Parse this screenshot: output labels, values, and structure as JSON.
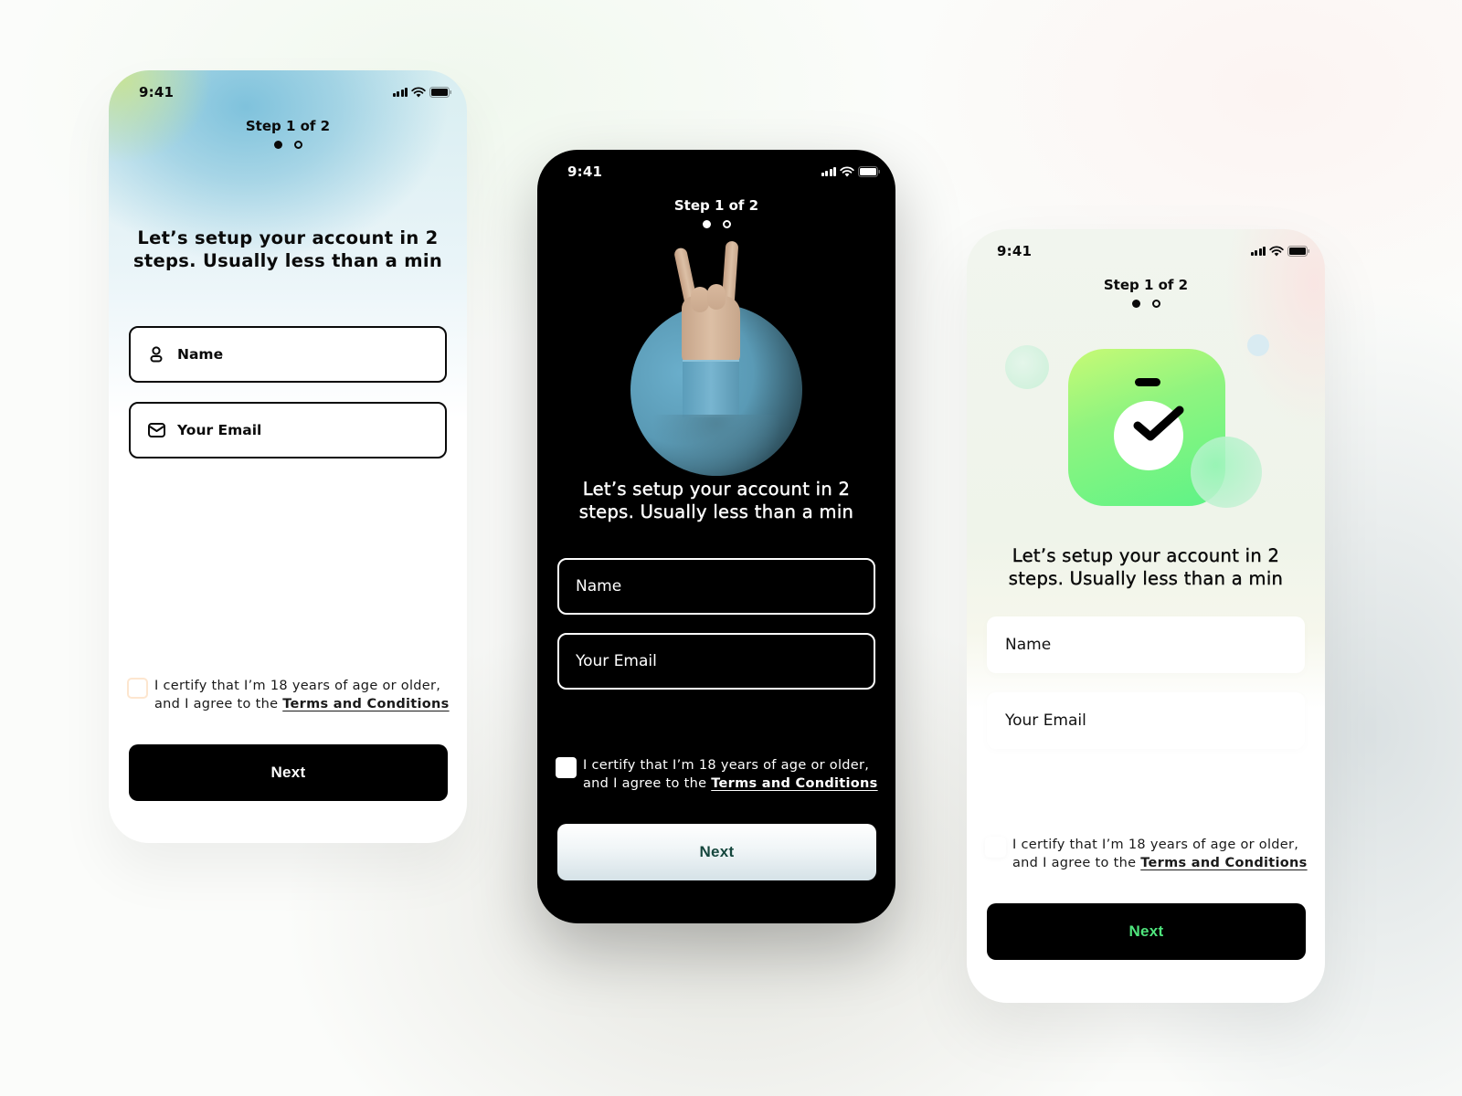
{
  "screens": [
    {
      "theme": "light-gradient",
      "status_bar": {
        "time": "9:41"
      },
      "step": {
        "label": "Step 1 of 2",
        "current": 1,
        "total": 2
      },
      "headline": "Let’s setup your account in 2 steps. Usually less than a min",
      "fields": {
        "name": {
          "placeholder": "Name",
          "icon": "user-icon"
        },
        "email": {
          "placeholder": "Your Email",
          "icon": "mail-icon"
        }
      },
      "consent": {
        "text": "I certify that I’m 18 years of age or older, and I agree to the ",
        "link": "Terms and Conditions",
        "checked": false
      },
      "next_button": {
        "label": "Next"
      },
      "colors": {
        "button_bg": "#000000",
        "button_text": "#ffffff"
      }
    },
    {
      "theme": "dark",
      "status_bar": {
        "time": "9:41"
      },
      "step": {
        "label": "Step 1 of 2",
        "current": 1,
        "total": 2
      },
      "illustration": "rock-hand-illustration",
      "headline": "Let’s setup your account in 2 steps. Usually less than a min",
      "fields": {
        "name": {
          "placeholder": "Name"
        },
        "email": {
          "placeholder": "Your Email"
        }
      },
      "consent": {
        "text": "I certify that I’m 18 years of age or older, and I agree to the ",
        "link": "Terms and Conditions",
        "checked": false
      },
      "next_button": {
        "label": "Next"
      },
      "colors": {
        "button_bg": "#eef3f5",
        "button_text": "#15463d"
      }
    },
    {
      "theme": "light-green",
      "status_bar": {
        "time": "9:41"
      },
      "step": {
        "label": "Step 1 of 2",
        "current": 1,
        "total": 2
      },
      "illustration": "stopwatch-check-illustration",
      "headline": "Let’s setup your account in 2 steps. Usually less than a min",
      "fields": {
        "name": {
          "placeholder": "Name"
        },
        "email": {
          "placeholder": "Your Email"
        }
      },
      "consent": {
        "text": "I certify that I’m 18 years of age or older, and I agree to the ",
        "link": "Terms and Conditions",
        "checked": false
      },
      "next_button": {
        "label": "Next"
      },
      "colors": {
        "button_bg": "#000000",
        "button_text": "#4fe57d",
        "tile_gradient": [
          "#c7fa75",
          "#5df387"
        ]
      }
    }
  ]
}
